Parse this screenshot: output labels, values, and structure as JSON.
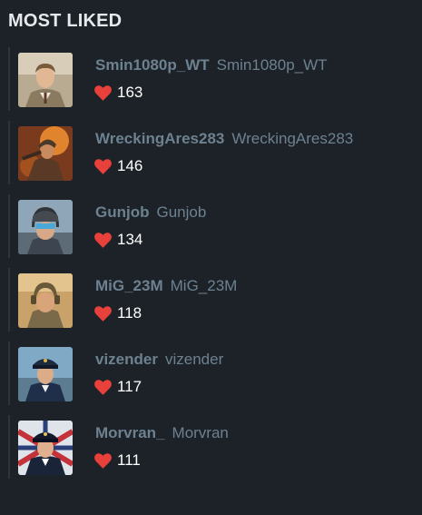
{
  "section": {
    "title": "MOST LIKED"
  },
  "users": [
    {
      "username": "Smin1080p_WT",
      "display_name": "Smin1080p_WT",
      "likes": "163",
      "avatar": "officer-portrait-icon"
    },
    {
      "username": "WreckingAres283",
      "display_name": "WreckingAres283",
      "likes": "146",
      "avatar": "soldier-portrait-icon"
    },
    {
      "username": "Gunjob",
      "display_name": "Gunjob",
      "likes": "134",
      "avatar": "pilot-helmet-portrait-icon"
    },
    {
      "username": "MiG_23M",
      "display_name": "MiG_23M",
      "likes": "118",
      "avatar": "tank-helmet-portrait-icon"
    },
    {
      "username": "vizender",
      "display_name": "vizender",
      "likes": "117",
      "avatar": "naval-officer-portrait-icon"
    },
    {
      "username": "Morvran_",
      "display_name": "Morvran",
      "likes": "111",
      "avatar": "navy-captain-portrait-icon"
    }
  ],
  "colors": {
    "background": "#1c2227",
    "heart": "#e8403a",
    "name": "#6d8190",
    "count": "#ffffff"
  }
}
